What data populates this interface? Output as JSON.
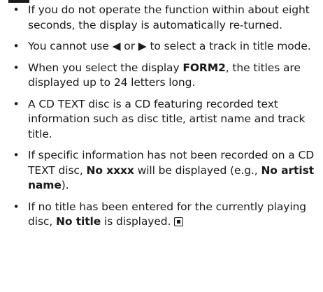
{
  "bullet_glyph": "•",
  "notes": [
    {
      "segments": [
        {
          "t": "If you do not operate the function within about eight seconds, the display is automatically re-turned."
        }
      ]
    },
    {
      "segments": [
        {
          "t": "You cannot use ◀ or ▶ to select a track in title mode."
        }
      ]
    },
    {
      "segments": [
        {
          "t": "When you select the display "
        },
        {
          "t": "FORM2",
          "b": true
        },
        {
          "t": ", the titles are displayed up to 24 letters long."
        }
      ]
    },
    {
      "segments": [
        {
          "t": "A CD TEXT disc is a CD featuring recorded text information such as disc title, artist name and track title."
        }
      ]
    },
    {
      "segments": [
        {
          "t": "If specific information has not been recorded on a CD TEXT disc, "
        },
        {
          "t": "No xxxx",
          "b": true
        },
        {
          "t": " will be displayed (e.g., "
        },
        {
          "t": "No artist name",
          "b": true
        },
        {
          "t": ")."
        }
      ]
    },
    {
      "segments": [
        {
          "t": "If no title has been entered for the currently playing disc, "
        },
        {
          "t": "No title",
          "b": true
        },
        {
          "t": " is displayed."
        }
      ],
      "end_mark": true
    }
  ]
}
